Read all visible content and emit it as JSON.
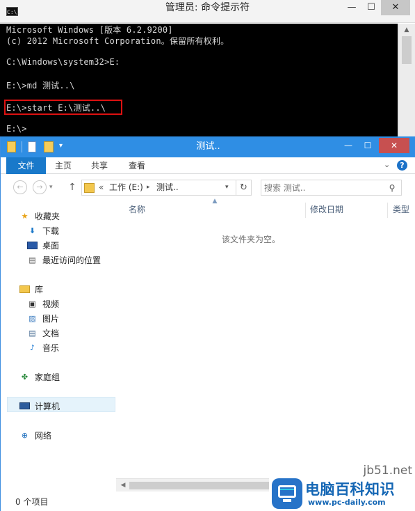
{
  "cmd": {
    "title": "管理员: 命令提示符",
    "icon_label": "C:\\.",
    "controls": {
      "min": "—",
      "max": "☐",
      "close": "✕"
    },
    "lines": [
      "Microsoft Windows [版本 6.2.9200]",
      "(c) 2012 Microsoft Corporation。保留所有权利。",
      "",
      "C:\\Windows\\system32>E:",
      "",
      "E:\\>md 测试..\\",
      "",
      "E:\\>start E:\\测试..\\",
      "",
      "E:\\>"
    ]
  },
  "explorer": {
    "title": "测试..",
    "controls": {
      "min": "—",
      "max": "☐",
      "close": "✕"
    },
    "ribbon": {
      "tabs": [
        "文件",
        "主页",
        "共享",
        "查看"
      ],
      "help": "?"
    },
    "address": {
      "lead": "«",
      "segments": [
        "工作 (E:)",
        "测试.."
      ],
      "separator": "▸"
    },
    "search": {
      "placeholder": "搜索 测试.."
    },
    "nav": {
      "favorites": {
        "label": "收藏夹",
        "items": [
          "下载",
          "桌面",
          "最近访问的位置"
        ]
      },
      "libraries": {
        "label": "库",
        "items": [
          "视频",
          "图片",
          "文档",
          "音乐"
        ]
      },
      "homegroup": "家庭组",
      "computer": "计算机",
      "network": "网络"
    },
    "columns": [
      "名称",
      "修改日期",
      "类型"
    ],
    "empty_message": "该文件夹为空。",
    "status": "0 个项目"
  },
  "watermark": {
    "site": "jb51.net",
    "logo_name": "电脑百科知识",
    "logo_url": "www.pc-daily.com"
  },
  "icons": {
    "accent": "#2f8ee4",
    "file_tab": "#1979ca",
    "close_red": "#c75050"
  }
}
